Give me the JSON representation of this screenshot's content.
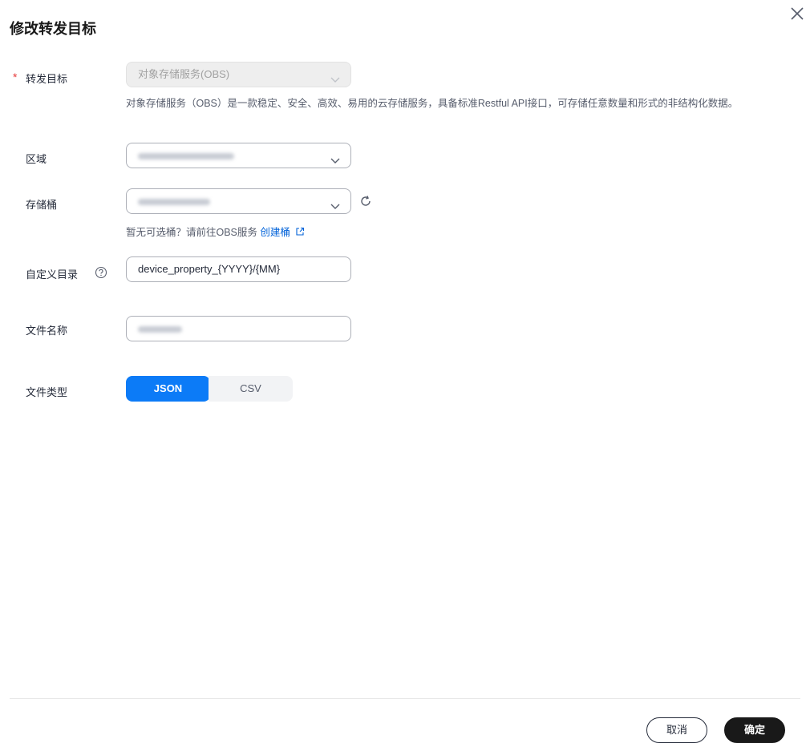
{
  "dialog": {
    "title": "修改转发目标",
    "close_icon": "close-icon"
  },
  "form": {
    "target": {
      "label": "转发目标",
      "required_mark": "*",
      "value": "对象存储服务(OBS)",
      "description": "对象存储服务（OBS）是一款稳定、安全、高效、易用的云存储服务，具备标准Restful API接口，可存储任意数量和形式的非结构化数据。"
    },
    "region": {
      "label": "区域"
    },
    "bucket": {
      "label": "存储桶",
      "hint_prefix": "暂无可选桶？请前往OBS服务 ",
      "hint_link": "创建桶"
    },
    "custom_dir": {
      "label": "自定义目录",
      "value": "device_property_{YYYY}/{MM}"
    },
    "file_name": {
      "label": "文件名称"
    },
    "file_type": {
      "label": "文件类型",
      "options": [
        "JSON",
        "CSV"
      ],
      "selected": "JSON"
    }
  },
  "footer": {
    "cancel_label": "取消",
    "ok_label": "确定"
  },
  "colors": {
    "primary": "#0c7bf7",
    "link": "#0062d9",
    "required": "#e6393a",
    "dark_button": "#191919"
  }
}
